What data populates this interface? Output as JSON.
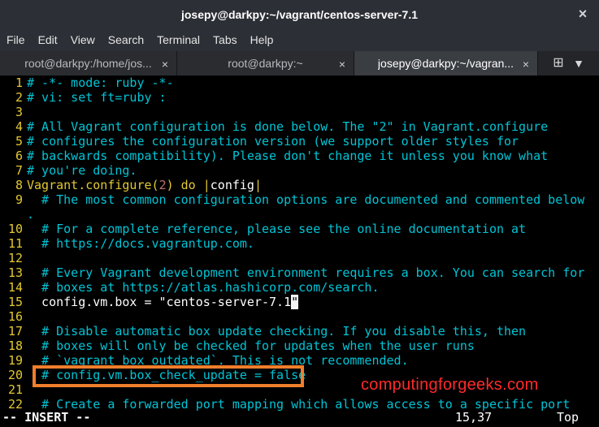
{
  "window": {
    "title": "josepy@darkpy:~/vagrant/centos-server-7.1",
    "close_icon": "close-icon"
  },
  "menubar": [
    "File",
    "Edit",
    "View",
    "Search",
    "Terminal",
    "Tabs",
    "Help"
  ],
  "tabs": [
    {
      "label": "root@darkpy:/home/jos...",
      "active": false
    },
    {
      "label": "root@darkpy:~",
      "active": false
    },
    {
      "label": "josepy@darkpy:~/vagran...",
      "active": true
    }
  ],
  "tab_controls": {
    "new_tab": "new-tab-icon",
    "menu": "menu-icon"
  },
  "editor": {
    "lines": [
      {
        "num": "1",
        "text": "# -*- mode: ruby -*-"
      },
      {
        "num": "2",
        "text": "# vi: set ft=ruby :"
      },
      {
        "num": "3",
        "text": ""
      },
      {
        "num": "4",
        "text": "# All Vagrant configuration is done below. The \"2\" in Vagrant.configure"
      },
      {
        "num": "5",
        "text": "# configures the configuration version (we support older styles for"
      },
      {
        "num": "6",
        "text": "# backwards compatibility). Please don't change it unless you know what"
      },
      {
        "num": "7",
        "text": "# you're doing."
      },
      {
        "num": "8",
        "text": "Vagrant.configure(2) do |config|"
      },
      {
        "num": "9",
        "text": "  # The most common configuration options are documented and commented below"
      },
      {
        "num": "",
        "text": "."
      },
      {
        "num": "10",
        "text": "  # For a complete reference, please see the online documentation at"
      },
      {
        "num": "11",
        "text": "  # https://docs.vagrantup.com."
      },
      {
        "num": "12",
        "text": ""
      },
      {
        "num": "13",
        "text": "  # Every Vagrant development environment requires a box. You can search for"
      },
      {
        "num": "14",
        "text": "  # boxes at https://atlas.hashicorp.com/search."
      },
      {
        "num": "15",
        "text": "  config.vm.box = \"centos-server-7.1\""
      },
      {
        "num": "16",
        "text": ""
      },
      {
        "num": "17",
        "text": "  # Disable automatic box update checking. If you disable this, then"
      },
      {
        "num": "18",
        "text": "  # boxes will only be checked for updates when the user runs"
      },
      {
        "num": "19",
        "text": "  # `vagrant box outdated`. This is not recommended."
      },
      {
        "num": "20",
        "text": "  # config.vm.box_check_update = false"
      },
      {
        "num": "21",
        "text": ""
      },
      {
        "num": "22",
        "text": "  # Create a forwarded port mapping which allows access to a specific port"
      }
    ]
  },
  "status": {
    "mode": "-- INSERT --",
    "position": "15,37",
    "scroll": "Top"
  },
  "watermark": "computingforgeeks.com"
}
